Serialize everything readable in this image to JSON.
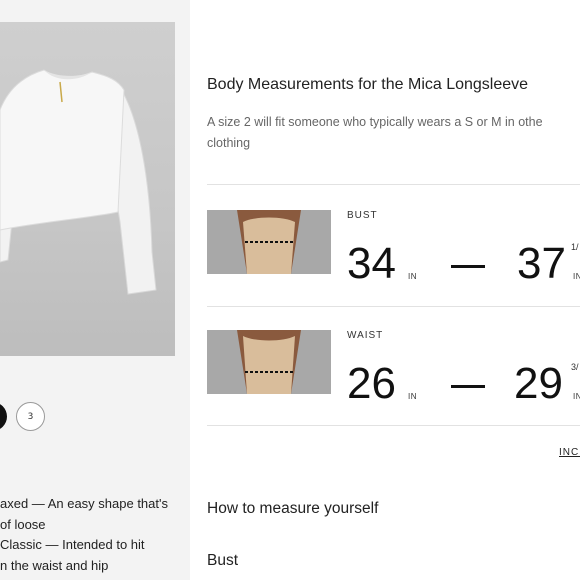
{
  "product": {
    "size_selector": {
      "selected_size": "",
      "sizes": [
        "3"
      ]
    },
    "fit_description": {
      "lines": [
        "axed — An easy shape that's",
        "of loose",
        "Classic — Intended to hit",
        "n the waist and hip"
      ]
    }
  },
  "measurements": {
    "heading": "Body Measurements for the Mica Longsleeve",
    "description_lines": [
      "A size 2 will fit someone who typically wears a S or M in othe",
      "clothing"
    ],
    "rows": [
      {
        "label": "BUST",
        "from_value": "34",
        "from_unit": "IN",
        "to_value": "37",
        "to_fraction": "1/",
        "to_unit": "IN"
      },
      {
        "label": "WAIST",
        "from_value": "26",
        "from_unit": "IN",
        "to_value": "29",
        "to_fraction": "3/",
        "to_unit": "IN"
      }
    ],
    "unit_toggle_label": "INCH"
  },
  "how_to": {
    "heading": "How to measure yourself",
    "first_section": "Bust"
  },
  "colors": {
    "accent": "#111111",
    "muted_text": "#666666",
    "divider": "#e2e2e2",
    "panel_bg": "#f3f3f3"
  }
}
